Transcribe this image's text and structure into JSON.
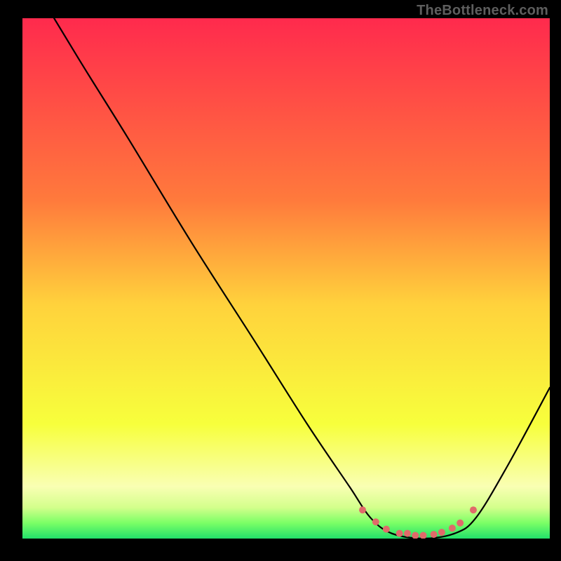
{
  "watermark": "TheBottleneck.com",
  "chart_data": {
    "type": "line",
    "title": "",
    "xlabel": "",
    "ylabel": "",
    "xlim": [
      0,
      100
    ],
    "ylim": [
      0,
      100
    ],
    "grid": false,
    "watermark": "TheBottleneck.com",
    "gradient_stops": [
      {
        "offset": 0,
        "color": "#ff2a4d"
      },
      {
        "offset": 35,
        "color": "#ff7a3c"
      },
      {
        "offset": 55,
        "color": "#ffd23c"
      },
      {
        "offset": 78,
        "color": "#f7ff3c"
      },
      {
        "offset": 90,
        "color": "#f9ffb3"
      },
      {
        "offset": 94,
        "color": "#d4ff8c"
      },
      {
        "offset": 97,
        "color": "#7bff66"
      },
      {
        "offset": 100,
        "color": "#22e06a"
      }
    ],
    "curve": {
      "name": "bottleneck-curve",
      "color": "#000000",
      "points": [
        {
          "x": 6,
          "y": 100
        },
        {
          "x": 12,
          "y": 90
        },
        {
          "x": 20,
          "y": 77
        },
        {
          "x": 32,
          "y": 57
        },
        {
          "x": 44,
          "y": 38
        },
        {
          "x": 54,
          "y": 22
        },
        {
          "x": 62,
          "y": 10
        },
        {
          "x": 66,
          "y": 4
        },
        {
          "x": 70,
          "y": 1
        },
        {
          "x": 76,
          "y": 0
        },
        {
          "x": 82,
          "y": 1
        },
        {
          "x": 86,
          "y": 4
        },
        {
          "x": 92,
          "y": 14
        },
        {
          "x": 100,
          "y": 29
        }
      ]
    },
    "markers": {
      "name": "optimal-zone-markers",
      "color": "#e06a6a",
      "radius": 5,
      "points": [
        {
          "x": 64.5,
          "y": 5.5
        },
        {
          "x": 67,
          "y": 3.2
        },
        {
          "x": 69,
          "y": 1.8
        },
        {
          "x": 71.5,
          "y": 1.0
        },
        {
          "x": 73,
          "y": 1.0
        },
        {
          "x": 74.5,
          "y": 0.6
        },
        {
          "x": 76,
          "y": 0.6
        },
        {
          "x": 78,
          "y": 0.8
        },
        {
          "x": 79.5,
          "y": 1.2
        },
        {
          "x": 81.5,
          "y": 2.0
        },
        {
          "x": 83,
          "y": 3.0
        },
        {
          "x": 85.5,
          "y": 5.5
        }
      ]
    }
  }
}
